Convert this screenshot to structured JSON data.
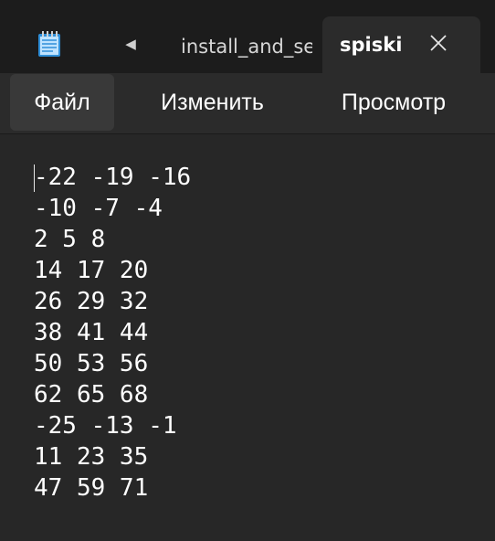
{
  "tabs": {
    "inactive_label": "install_and_se",
    "active_label": "spiski"
  },
  "menu": {
    "file": "Файл",
    "edit": "Изменить",
    "view": "Просмотр"
  },
  "document": {
    "lines": [
      "-22 -19 -16",
      "-10 -7 -4",
      "2 5 8",
      "14 17 20",
      "26 29 32",
      "38 41 44",
      "50 53 56",
      "62 65 68",
      "-25 -13 -1",
      "11 23 35",
      "47 59 71"
    ]
  },
  "icons": {
    "app": "notepad-icon",
    "scroll": "caret-left-icon",
    "close": "close-icon"
  },
  "colors": {
    "accent_app_icon": "#2f8fd8"
  }
}
